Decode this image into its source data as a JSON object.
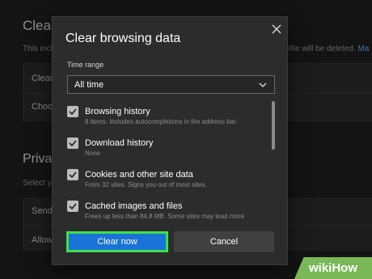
{
  "background": {
    "title": "Clear",
    "description_left": "This incl",
    "description_right": "rofile will be deleted.",
    "description_link": "Ma",
    "rows": [
      "Clear",
      "Choo"
    ],
    "section_title": "Privac",
    "section_desc": "Select yo",
    "rows2": [
      "Send",
      "Allow"
    ]
  },
  "dialog": {
    "title": "Clear browsing data",
    "time_range_label": "Time range",
    "time_range_value": "All time",
    "items": [
      {
        "label": "Browsing history",
        "sub": "8 items. Includes autocompletions in the address bar.",
        "checked": true
      },
      {
        "label": "Download history",
        "sub": "None",
        "checked": true
      },
      {
        "label": "Cookies and other site data",
        "sub": "From 32 sites. Signs you out of most sites.",
        "checked": true
      },
      {
        "label": "Cached images and files",
        "sub": "Frees up less than 84.8 MB. Some sites may load more",
        "checked": true
      }
    ],
    "clear_button": "Clear now",
    "cancel_button": "Cancel"
  },
  "watermark": "wikiHow",
  "colors": {
    "primary": "#1a73d6",
    "highlight": "#3ee04a",
    "dialog_bg": "#2c2c2c"
  }
}
